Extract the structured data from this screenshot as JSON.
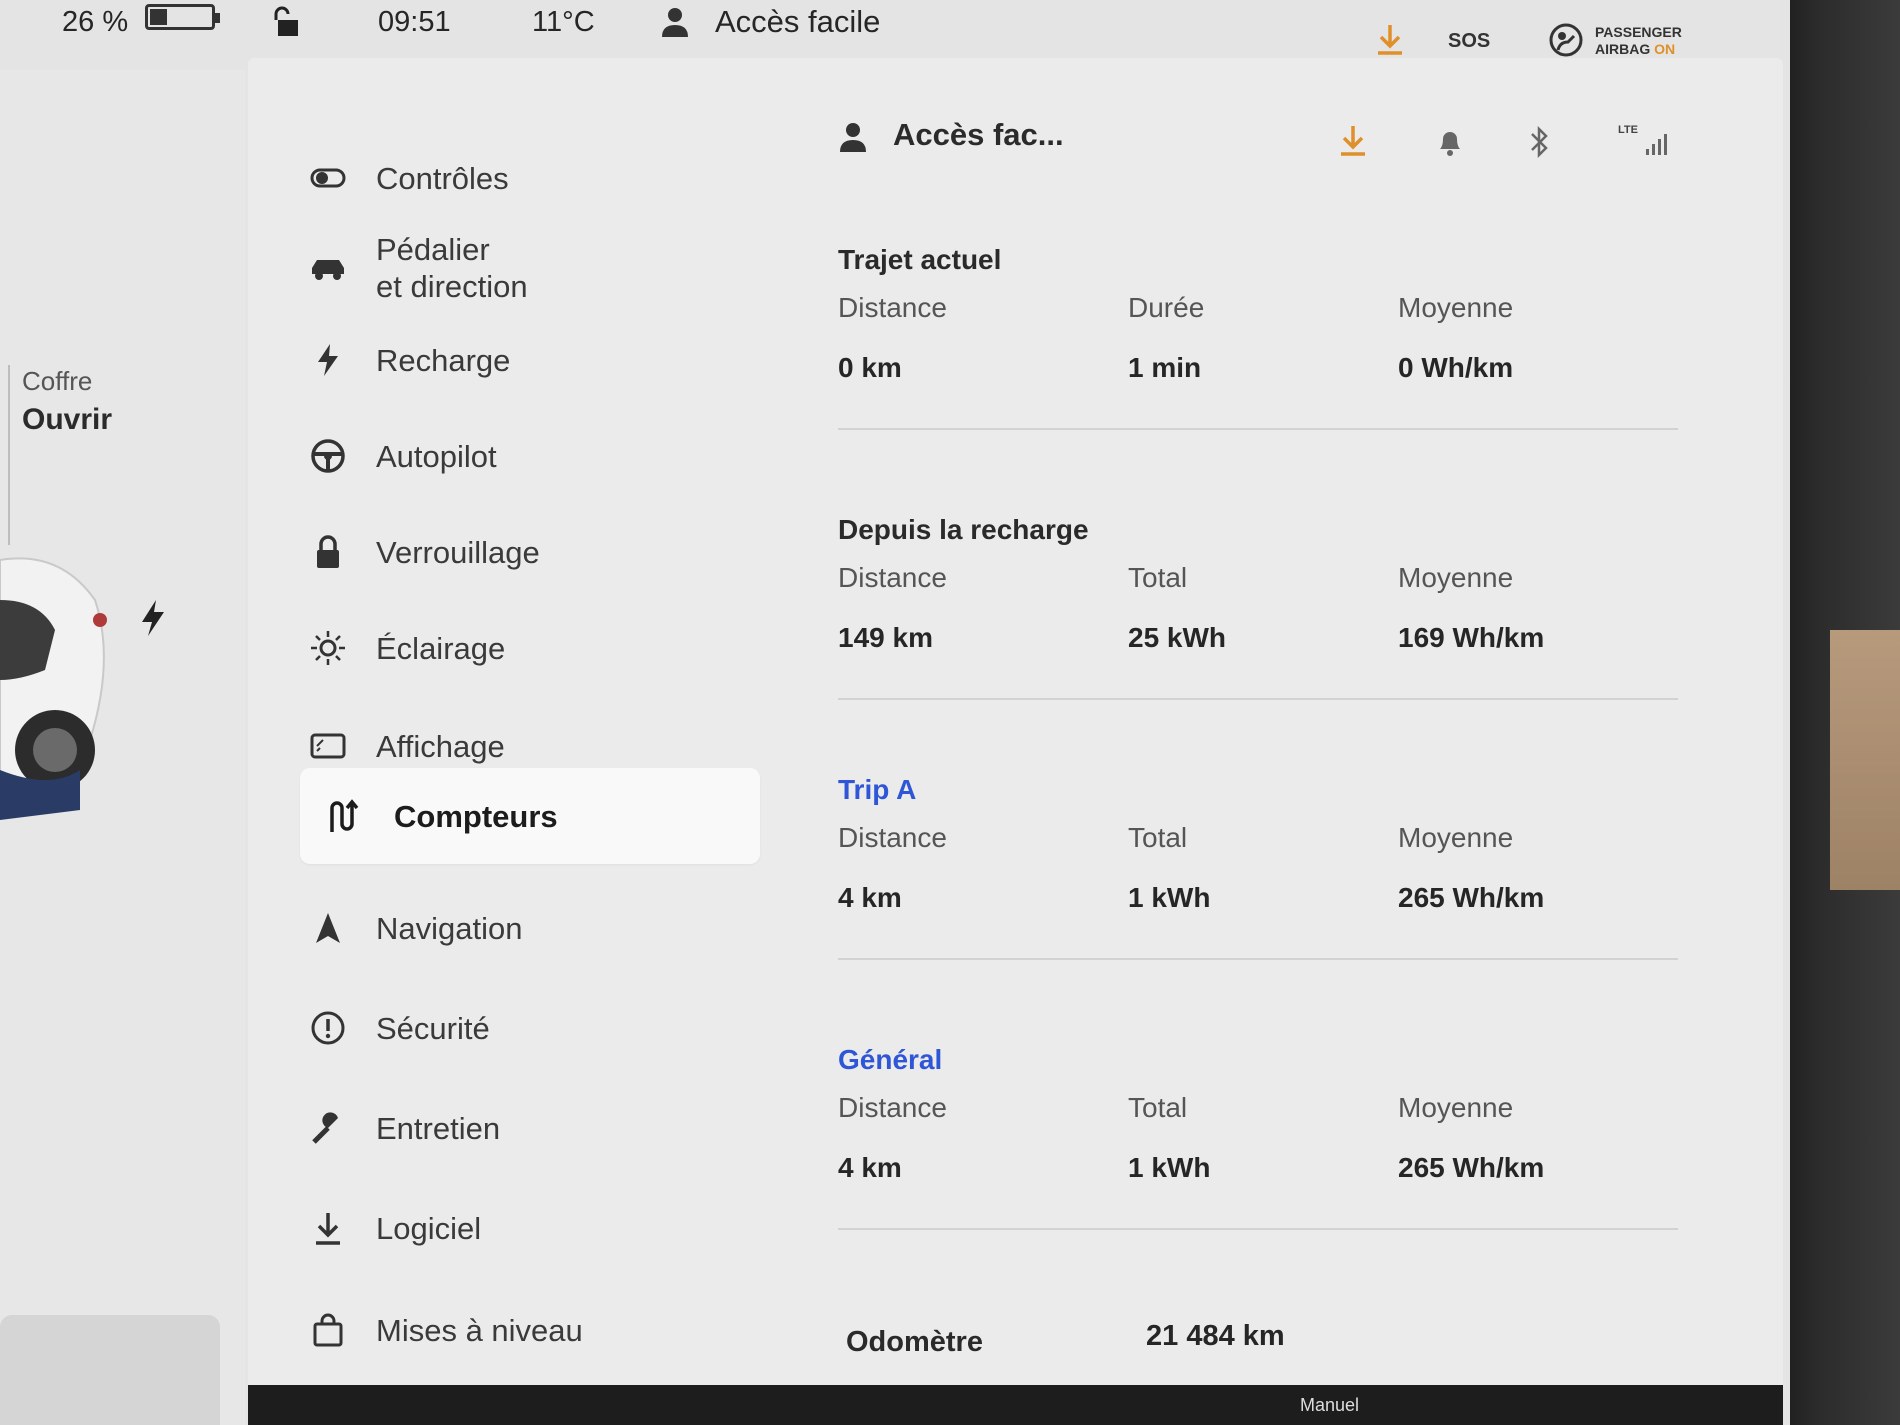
{
  "status_bar": {
    "battery_percent": "26 %",
    "battery_level": 0.26,
    "time": "09:51",
    "temperature": "11°C",
    "profile_name": "Accès facile",
    "sos_label": "SOS",
    "airbag_line1": "PASSENGER",
    "airbag_line2": "AIRBAG",
    "airbag_state": "ON"
  },
  "car_panel": {
    "trunk_label": "Coffre",
    "trunk_action": "Ouvrir"
  },
  "menu": {
    "items": [
      {
        "label": "Contrôles",
        "icon": "toggle-icon"
      },
      {
        "label": "Pédalier",
        "label2": "et direction",
        "icon": "car-icon"
      },
      {
        "label": "Recharge",
        "icon": "bolt-icon"
      },
      {
        "label": "Autopilot",
        "icon": "steering-wheel-icon"
      },
      {
        "label": "Verrouillage",
        "icon": "lock-icon"
      },
      {
        "label": "Éclairage",
        "icon": "sun-icon"
      },
      {
        "label": "Affichage",
        "icon": "display-icon"
      },
      {
        "label": "Compteurs",
        "icon": "trips-icon",
        "active": true
      },
      {
        "label": "Navigation",
        "icon": "navigation-arrow-icon"
      },
      {
        "label": "Sécurité",
        "icon": "alert-circle-icon"
      },
      {
        "label": "Entretien",
        "icon": "wrench-icon"
      },
      {
        "label": "Logiciel",
        "icon": "download-icon"
      },
      {
        "label": "Mises à niveau",
        "icon": "shopping-bag-icon"
      }
    ]
  },
  "content_header": {
    "profile_name": "Accès fac...",
    "lte_label": "LTE"
  },
  "sections": {
    "current_trip": {
      "title": "Trajet actuel",
      "col1_label": "Distance",
      "col1_value": "0  km",
      "col2_label": "Durée",
      "col2_value": "1 min",
      "col3_label": "Moyenne",
      "col3_value": "0 Wh/km"
    },
    "since_charge": {
      "title": "Depuis la recharge",
      "col1_label": "Distance",
      "col1_value": "149  km",
      "col2_label": "Total",
      "col2_value": "25 kWh",
      "col3_label": "Moyenne",
      "col3_value": "169 Wh/km"
    },
    "trip_a": {
      "title": "Trip A",
      "col1_label": "Distance",
      "col1_value": "4  km",
      "col2_label": "Total",
      "col2_value": "1 kWh",
      "col3_label": "Moyenne",
      "col3_value": "265 Wh/km"
    },
    "general": {
      "title": "Général",
      "col1_label": "Distance",
      "col1_value": "4  km",
      "col2_label": "Total",
      "col2_value": "1 kWh",
      "col3_label": "Moyenne",
      "col3_value": "265 Wh/km"
    }
  },
  "odometer": {
    "label": "Odomètre",
    "value": "21 484  km"
  },
  "footer": {
    "mode": "Manuel"
  },
  "colors": {
    "accent_blue": "#2e56d6",
    "accent_orange": "#e0902a",
    "background": "#ebebeb"
  }
}
